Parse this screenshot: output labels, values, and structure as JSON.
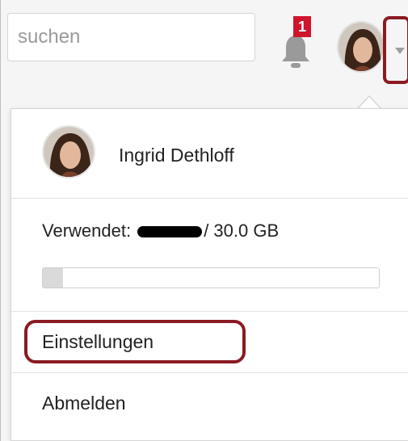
{
  "header": {
    "search": {
      "placeholder": "suchen",
      "value": ""
    },
    "notifications": {
      "count": "1",
      "icon": "bell-icon"
    },
    "avatar": {
      "icon": "user-avatar"
    },
    "menu_toggle": {
      "icon": "caret-down-icon"
    }
  },
  "user_menu": {
    "user_name": "Ingrid Dethloff",
    "storage": {
      "label_prefix": "Verwendet:",
      "label_suffix": "/ 30.0 GB",
      "used_fraction": 0.06
    },
    "items": [
      {
        "label": "Einstellungen"
      },
      {
        "label": "Abmelden"
      }
    ]
  },
  "colors": {
    "annotation": "#8b1a22",
    "badge": "#d0142c"
  }
}
